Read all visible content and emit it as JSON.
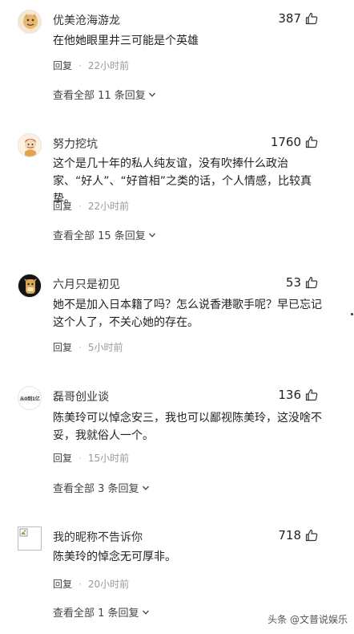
{
  "comments": [
    {
      "username": "优美沧海游龙",
      "likes": "387",
      "text": "在他她眼里井三可能是个英雄",
      "reply_label": "回复",
      "dot": "·",
      "time": "22小时前",
      "view_all": "查看全部 11 条回复"
    },
    {
      "username": "努力挖坑",
      "likes": "1760",
      "text": "这个是几十年的私人纯友谊，没有吹捧什么政治家、“好人”、“好首相”之类的话，个人情感，比较真挚。",
      "reply_label": "回复",
      "dot": "·",
      "time": "22小时前",
      "view_all": "查看全部 15 条回复"
    },
    {
      "username": "六月只是初见",
      "likes": "53",
      "text": "她不是加入日本籍了吗？怎么说香港歌手呢？早已忘记这个人了，不关心她的存在。",
      "reply_label": "回复",
      "dot": "·",
      "time": "5小时前"
    },
    {
      "username": "磊哥创业谈",
      "likes": "136",
      "avatar_text": "从0到1亿",
      "text": "陈美玲可以悼念安三，我也可以鄙视陈美玲，这没啥不妥，我就俗人一个。",
      "reply_label": "回复",
      "dot": "·",
      "time": "15小时前",
      "view_all": "查看全部 3 条回复"
    },
    {
      "username": "我的昵称不告诉你",
      "likes": "718",
      "text": "陈美玲的悼念无可厚非。",
      "reply_label": "回复",
      "dot": "·",
      "time": "20小时前",
      "view_all": "查看全部 1 条回复"
    }
  ],
  "watermark": "头条 @文普说娱乐",
  "icons": {
    "like": "thumbs-up-icon",
    "expand": "chevron-down-icon"
  }
}
